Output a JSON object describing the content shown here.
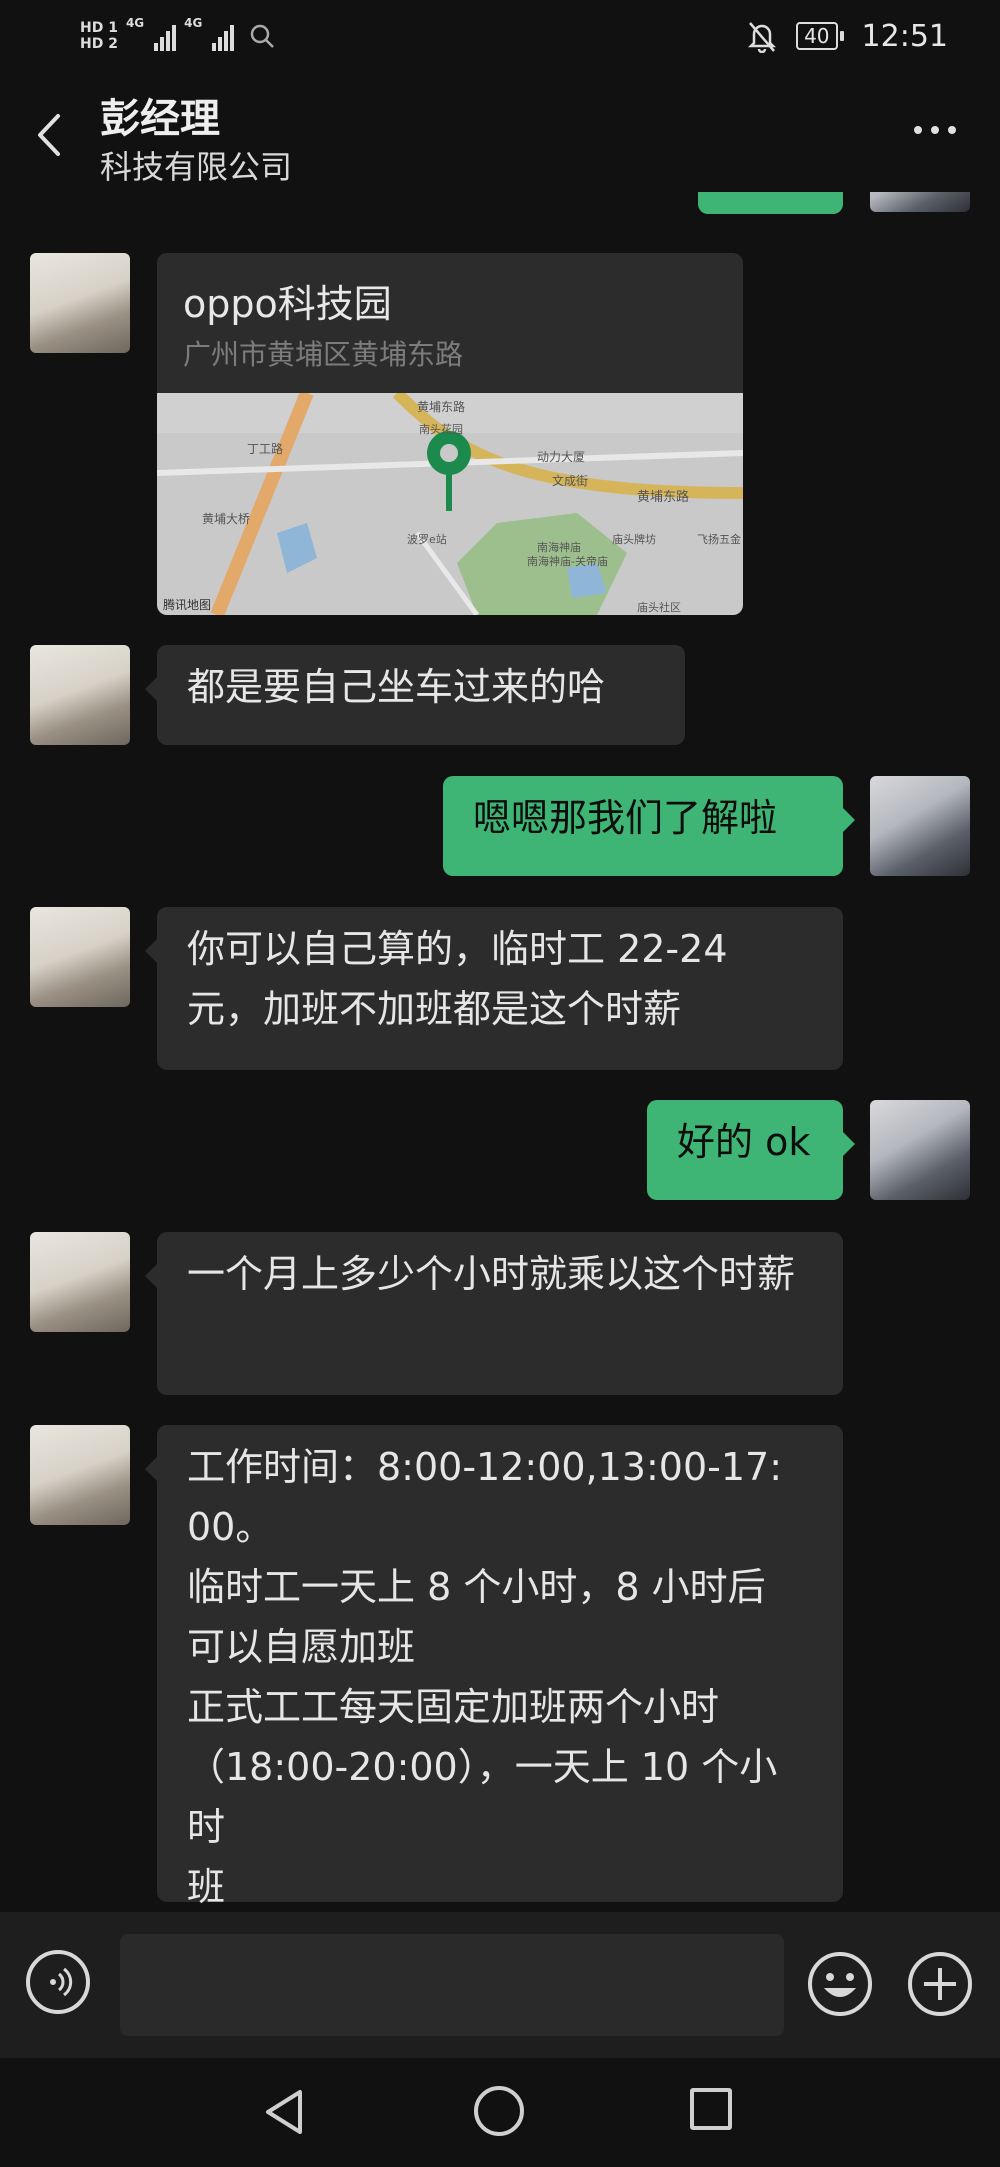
{
  "status_bar": {
    "hd1": "HD 1",
    "hd2": "HD 2",
    "net1": "4G",
    "net2": "4G",
    "battery": "40",
    "time": "12:51",
    "icons": [
      "signal-icon",
      "search-icon",
      "mute-bell-icon",
      "battery-icon"
    ]
  },
  "header": {
    "title": "彭经理",
    "subtitle": "科技有限公司",
    "icons": [
      "back-arrow-icon",
      "more-dots-icon"
    ]
  },
  "messages": [
    {
      "side": "out",
      "type": "text",
      "text": ""
    },
    {
      "side": "in",
      "type": "location",
      "name": "oppo科技园",
      "address": "广州市黄埔区黄埔东路",
      "map_labels": [
        "黄埔东路",
        "黄埔东路",
        "动力大厦",
        "文成街",
        "南头花园",
        "南海神庙",
        "南海神庙-关帝庙",
        "庙头牌坊",
        "飞扬五金",
        "波罗e站",
        "庙头社区",
        "丁工路",
        "黄埔大桥",
        "腾讯地图"
      ]
    },
    {
      "side": "in",
      "type": "text",
      "text": "都是要自己坐车过来的哈"
    },
    {
      "side": "out",
      "type": "text",
      "text": "嗯嗯那我们了解啦"
    },
    {
      "side": "in",
      "type": "text",
      "text": "你可以自己算的，临时工 22-24 元，加班不加班都是这个时薪"
    },
    {
      "side": "out",
      "type": "text",
      "text": "好的 ok"
    },
    {
      "side": "in",
      "type": "text",
      "text": "一个月上多少个小时就乘以这个时薪"
    },
    {
      "side": "in",
      "type": "text",
      "lines": [
        "工作时间：8:00-12:00,13:00-17:",
        "00。",
        "临时工一天上 8 个小时，8 小时后",
        "可以自愿加班",
        "正式工工每天固定加班两个小时",
        "（18:00-20:00），一天上 10 个小时",
        "班"
      ]
    }
  ],
  "input_bar": {
    "placeholder": "",
    "icons": [
      "voice-icon",
      "emoji-icon",
      "plus-icon"
    ]
  },
  "nav_bar": {
    "icons": [
      "nav-back-icon",
      "nav-home-icon",
      "nav-recents-icon"
    ]
  },
  "colors": {
    "background": "#111111",
    "incoming_bubble": "#2c2c2c",
    "outgoing_bubble": "#3eb575",
    "input_bar": "#1e1e1e"
  }
}
